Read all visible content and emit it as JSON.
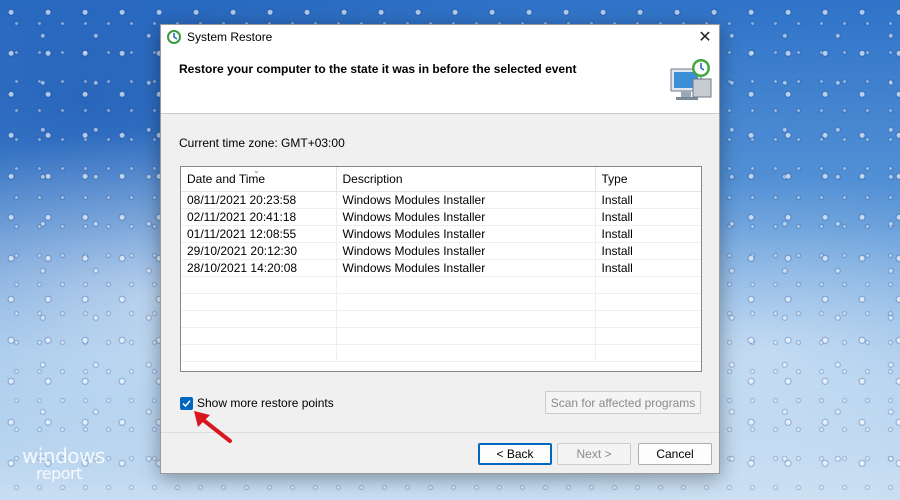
{
  "window": {
    "title": "System Restore",
    "close_label": "✕"
  },
  "header": {
    "title": "Restore your computer to the state it was in before the selected event"
  },
  "timezone_label": "Current time zone: GMT+03:00",
  "table": {
    "columns": [
      "Date and Time",
      "Description",
      "Type"
    ],
    "sort_indicator": "⌄",
    "rows": [
      [
        "08/11/2021 20:23:58",
        "Windows Modules Installer",
        "Install"
      ],
      [
        "02/11/2021 20:41:18",
        "Windows Modules Installer",
        "Install"
      ],
      [
        "01/11/2021 12:08:55",
        "Windows Modules Installer",
        "Install"
      ],
      [
        "29/10/2021 20:12:30",
        "Windows Modules Installer",
        "Install"
      ],
      [
        "28/10/2021 14:20:08",
        "Windows Modules Installer",
        "Install"
      ]
    ]
  },
  "options": {
    "show_more_label": "Show more restore points",
    "show_more_checked": true,
    "scan_button": "Scan for affected programs"
  },
  "buttons": {
    "back": "< Back",
    "next": "Next >",
    "cancel": "Cancel"
  },
  "watermark": {
    "line1": "windows",
    "line2": "report"
  },
  "colors": {
    "accent": "#0067c0",
    "arrow": "#d8161f"
  }
}
